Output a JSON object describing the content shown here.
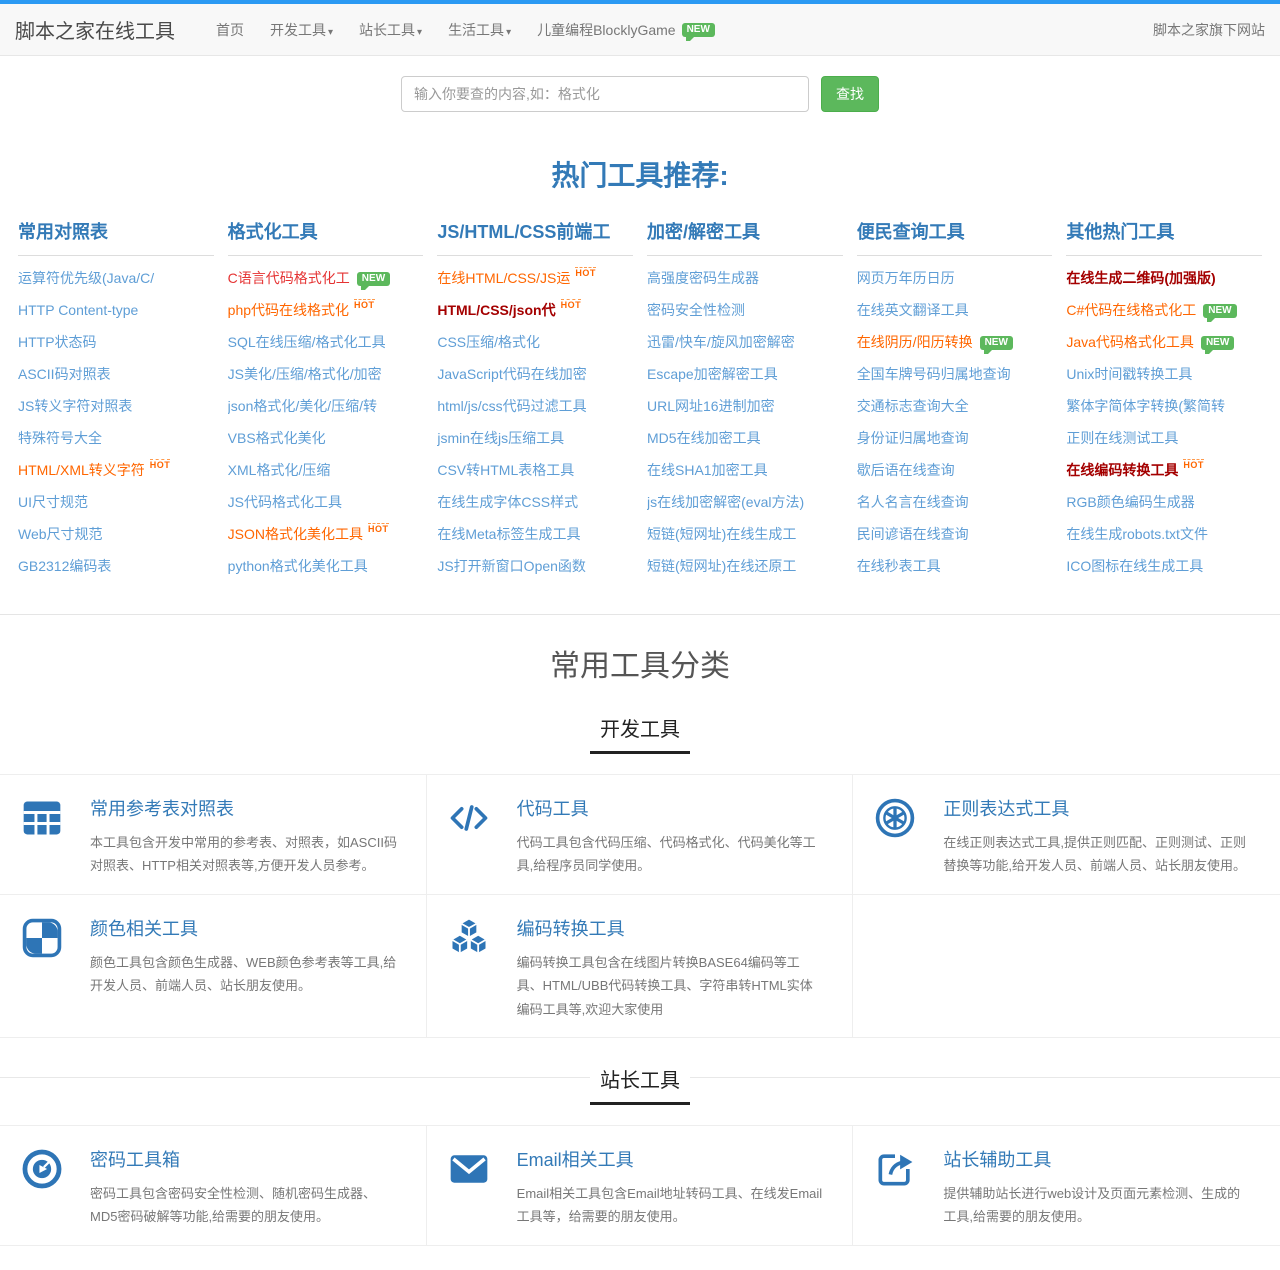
{
  "colors": {
    "accent_blue": "#2b9af3",
    "heading_blue": "#337ab7",
    "link_blue": "#5f9ed6",
    "green": "#5cb85c",
    "orange": "#ff6600",
    "red": "#e53333",
    "dark_red": "#a40000"
  },
  "navbar": {
    "brand": "脚本之家在线工具",
    "items": [
      {
        "name": "home",
        "label": "首页",
        "dropdown": false,
        "badge": null
      },
      {
        "name": "dev-tools",
        "label": "开发工具",
        "dropdown": true,
        "badge": null
      },
      {
        "name": "webmaster-tools",
        "label": "站长工具",
        "dropdown": true,
        "badge": null
      },
      {
        "name": "life-tools",
        "label": "生活工具",
        "dropdown": true,
        "badge": null
      },
      {
        "name": "blockly-game",
        "label": "儿童编程BlocklyGame",
        "dropdown": false,
        "badge": "NEW"
      }
    ],
    "right_link": "脚本之家旗下网站"
  },
  "search": {
    "placeholder": "输入你要查的内容,如：格式化",
    "button": "查找"
  },
  "hot_section": {
    "title": "热门工具推荐:",
    "columns": [
      {
        "name": "reference-tables",
        "header": "常用对照表",
        "links": [
          {
            "text": "运算符优先级(Java/C/",
            "style": "normal",
            "badge": null
          },
          {
            "text": "HTTP Content-type",
            "style": "normal",
            "badge": null
          },
          {
            "text": "HTTP状态码",
            "style": "normal",
            "badge": null
          },
          {
            "text": "ASCII码对照表",
            "style": "normal",
            "badge": null
          },
          {
            "text": "JS转义字符对照表",
            "style": "normal",
            "badge": null
          },
          {
            "text": "特殊符号大全",
            "style": "normal",
            "badge": null
          },
          {
            "text": "HTML/XML转义字符",
            "style": "orange",
            "badge": "HOT"
          },
          {
            "text": "UI尺寸规范",
            "style": "normal",
            "badge": null
          },
          {
            "text": "Web尺寸规范",
            "style": "normal",
            "badge": null
          },
          {
            "text": "GB2312编码表",
            "style": "normal",
            "badge": null
          }
        ]
      },
      {
        "name": "formatter-tools",
        "header": "格式化工具",
        "links": [
          {
            "text": "C语言代码格式化工",
            "style": "red",
            "badge": "NEW"
          },
          {
            "text": "php代码在线格式化",
            "style": "orange",
            "badge": "HOT"
          },
          {
            "text": "SQL在线压缩/格式化工具",
            "style": "normal",
            "badge": null
          },
          {
            "text": "JS美化/压缩/格式化/加密",
            "style": "normal",
            "badge": null
          },
          {
            "text": "json格式化/美化/压缩/转",
            "style": "normal",
            "badge": null
          },
          {
            "text": "VBS格式化美化",
            "style": "normal",
            "badge": null
          },
          {
            "text": "XML格式化/压缩",
            "style": "normal",
            "badge": null
          },
          {
            "text": "JS代码格式化工具",
            "style": "normal",
            "badge": null
          },
          {
            "text": "JSON格式化美化工具",
            "style": "orange",
            "badge": "HOT"
          },
          {
            "text": "python格式化美化工具",
            "style": "normal",
            "badge": null
          }
        ]
      },
      {
        "name": "frontend-tools",
        "header": "JS/HTML/CSS前端工",
        "links": [
          {
            "text": "在线HTML/CSS/JS运",
            "style": "orange",
            "badge": "HOT"
          },
          {
            "text": "HTML/CSS/json代",
            "style": "darkred",
            "badge": "HOT"
          },
          {
            "text": "CSS压缩/格式化",
            "style": "normal",
            "badge": null
          },
          {
            "text": "JavaScript代码在线加密",
            "style": "normal",
            "badge": null
          },
          {
            "text": "html/js/css代码过滤工具",
            "style": "normal",
            "badge": null
          },
          {
            "text": "jsmin在线js压缩工具",
            "style": "normal",
            "badge": null
          },
          {
            "text": "CSV转HTML表格工具",
            "style": "normal",
            "badge": null
          },
          {
            "text": "在线生成字体CSS样式",
            "style": "normal",
            "badge": null
          },
          {
            "text": "在线Meta标签生成工具",
            "style": "normal",
            "badge": null
          },
          {
            "text": "JS打开新窗口Open函数",
            "style": "normal",
            "badge": null
          }
        ]
      },
      {
        "name": "crypto-tools",
        "header": "加密/解密工具",
        "links": [
          {
            "text": "高强度密码生成器",
            "style": "normal",
            "badge": null
          },
          {
            "text": "密码安全性检测",
            "style": "normal",
            "badge": null
          },
          {
            "text": "迅雷/快车/旋风加密解密",
            "style": "normal",
            "badge": null
          },
          {
            "text": "Escape加密解密工具",
            "style": "normal",
            "badge": null
          },
          {
            "text": "URL网址16进制加密",
            "style": "normal",
            "badge": null
          },
          {
            "text": "MD5在线加密工具",
            "style": "normal",
            "badge": null
          },
          {
            "text": "在线SHA1加密工具",
            "style": "normal",
            "badge": null
          },
          {
            "text": "js在线加密解密(eval方法)",
            "style": "normal",
            "badge": null
          },
          {
            "text": "短链(短网址)在线生成工",
            "style": "normal",
            "badge": null
          },
          {
            "text": "短链(短网址)在线还原工",
            "style": "normal",
            "badge": null
          }
        ]
      },
      {
        "name": "query-tools",
        "header": "便民查询工具",
        "links": [
          {
            "text": "网页万年历日历",
            "style": "normal",
            "badge": null
          },
          {
            "text": "在线英文翻译工具",
            "style": "normal",
            "badge": null
          },
          {
            "text": "在线阴历/阳历转换",
            "style": "orange",
            "badge": "NEW"
          },
          {
            "text": "全国车牌号码归属地查询",
            "style": "normal",
            "badge": null
          },
          {
            "text": "交通标志查询大全",
            "style": "normal",
            "badge": null
          },
          {
            "text": "身份证归属地查询",
            "style": "normal",
            "badge": null
          },
          {
            "text": "歇后语在线查询",
            "style": "normal",
            "badge": null
          },
          {
            "text": "名人名言在线查询",
            "style": "normal",
            "badge": null
          },
          {
            "text": "民间谚语在线查询",
            "style": "normal",
            "badge": null
          },
          {
            "text": "在线秒表工具",
            "style": "normal",
            "badge": null
          }
        ]
      },
      {
        "name": "other-hot-tools",
        "header": "其他热门工具",
        "links": [
          {
            "text": "在线生成二维码(加强版)",
            "style": "darkred",
            "badge": null
          },
          {
            "text": "C#代码在线格式化工",
            "style": "orange",
            "badge": "NEW"
          },
          {
            "text": "Java代码格式化工具",
            "style": "orange",
            "badge": "NEW"
          },
          {
            "text": "Unix时间戳转换工具",
            "style": "normal",
            "badge": null
          },
          {
            "text": "繁体字简体字转换(繁简转",
            "style": "normal",
            "badge": null
          },
          {
            "text": "正则在线测试工具",
            "style": "normal",
            "badge": null
          },
          {
            "text": "在线编码转换工具",
            "style": "darkred",
            "badge": "HOT"
          },
          {
            "text": "RGB颜色编码生成器",
            "style": "normal",
            "badge": null
          },
          {
            "text": "在线生成robots.txt文件",
            "style": "normal",
            "badge": null
          },
          {
            "text": "ICO图标在线生成工具",
            "style": "normal",
            "badge": null
          }
        ]
      }
    ]
  },
  "category_section": {
    "title": "常用工具分类",
    "groups": [
      {
        "name": "dev-tools-group",
        "title": "开发工具",
        "legend_line": false,
        "cards": [
          {
            "icon": "table-icon",
            "title": "常用参考表对照表",
            "desc": "本工具包含开发中常用的参考表、对照表，如ASCII码对照表、HTTP相关对照表等,方便开发人员参考。"
          },
          {
            "icon": "code-icon",
            "title": "代码工具",
            "desc": "代码工具包含代码压缩、代码格式化、代码美化等工具,给程序员同学使用。"
          },
          {
            "icon": "regex-icon",
            "title": "正则表达式工具",
            "desc": "在线正则表达式工具,提供正则匹配、正则测试、正则替换等功能,给开发人员、前端人员、站长朋友使用。"
          },
          {
            "icon": "color-icon",
            "title": "颜色相关工具",
            "desc": "颜色工具包含颜色生成器、WEB颜色参考表等工具,给开发人员、前端人员、站长朋友使用。"
          },
          {
            "icon": "cubes-icon",
            "title": "编码转换工具",
            "desc": "编码转换工具包含在线图片转换BASE64编码等工具、HTML/UBB代码转换工具、字符串转HTML实体编码工具等,欢迎大家使用"
          }
        ]
      },
      {
        "name": "webmaster-tools-group",
        "title": "站长工具",
        "legend_line": true,
        "cards": [
          {
            "icon": "password-icon",
            "title": "密码工具箱",
            "desc": "密码工具包含密码安全性检测、随机密码生成器、MD5密码破解等功能,给需要的朋友使用。"
          },
          {
            "icon": "envelope-icon",
            "title": "Email相关工具",
            "desc": "Email相关工具包含Email地址转码工具、在线发Email工具等，给需要的朋友使用。"
          },
          {
            "icon": "share-icon",
            "title": "站长辅助工具",
            "desc": "提供辅助站长进行web设计及页面元素检测、生成的工具,给需要的朋友使用。"
          }
        ]
      }
    ]
  }
}
